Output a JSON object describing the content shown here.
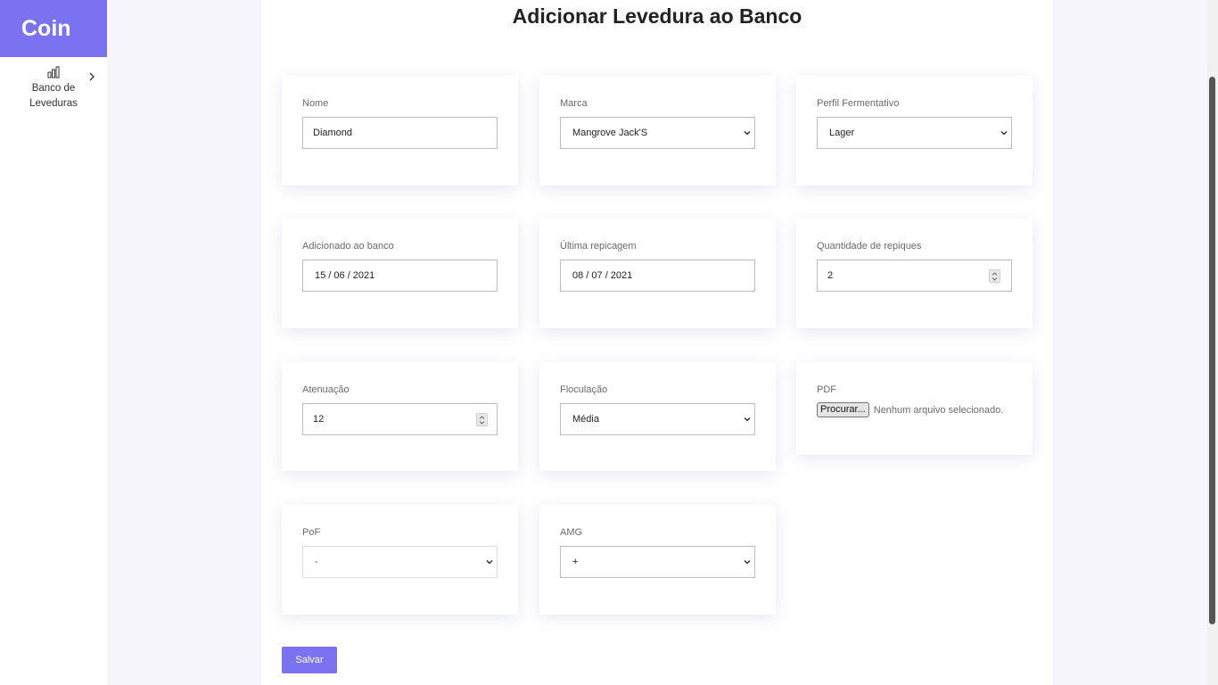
{
  "sidebar": {
    "brand": "Coin",
    "items": [
      {
        "label": "Banco de Leveduras",
        "icon": "bar-chart-icon"
      }
    ]
  },
  "page": {
    "title": "Adicionar Levedura ao Banco"
  },
  "form": {
    "nome": {
      "label": "Nome",
      "value": "Diamond"
    },
    "marca": {
      "label": "Marca",
      "value": "Mangrove Jack'S"
    },
    "perfil": {
      "label": "Perfil Fermentativo",
      "value": "Lager"
    },
    "adicionado": {
      "label": "Adicionado ao banco",
      "value": "15 / 06 / 2021"
    },
    "ultima_repicagem": {
      "label": "Última repicagem",
      "value": "08 / 07 / 2021"
    },
    "quantidade_repiques": {
      "label": "Quantidade de repiques",
      "value": "2"
    },
    "atenuacao": {
      "label": "Atenuação",
      "value": "12"
    },
    "floculacao": {
      "label": "Floculação",
      "value": "Média"
    },
    "pdf": {
      "label": "PDF",
      "button_label": "Procurar...",
      "status": "Nenhum arquivo selecionado."
    },
    "pof": {
      "label": "PoF",
      "value": "-"
    },
    "amg": {
      "label": "AMG",
      "value": "+"
    },
    "save_label": "Salvar"
  },
  "colors": {
    "accent": "#7b72f2",
    "background": "#f6f6fc",
    "panel": "#ffffff"
  }
}
